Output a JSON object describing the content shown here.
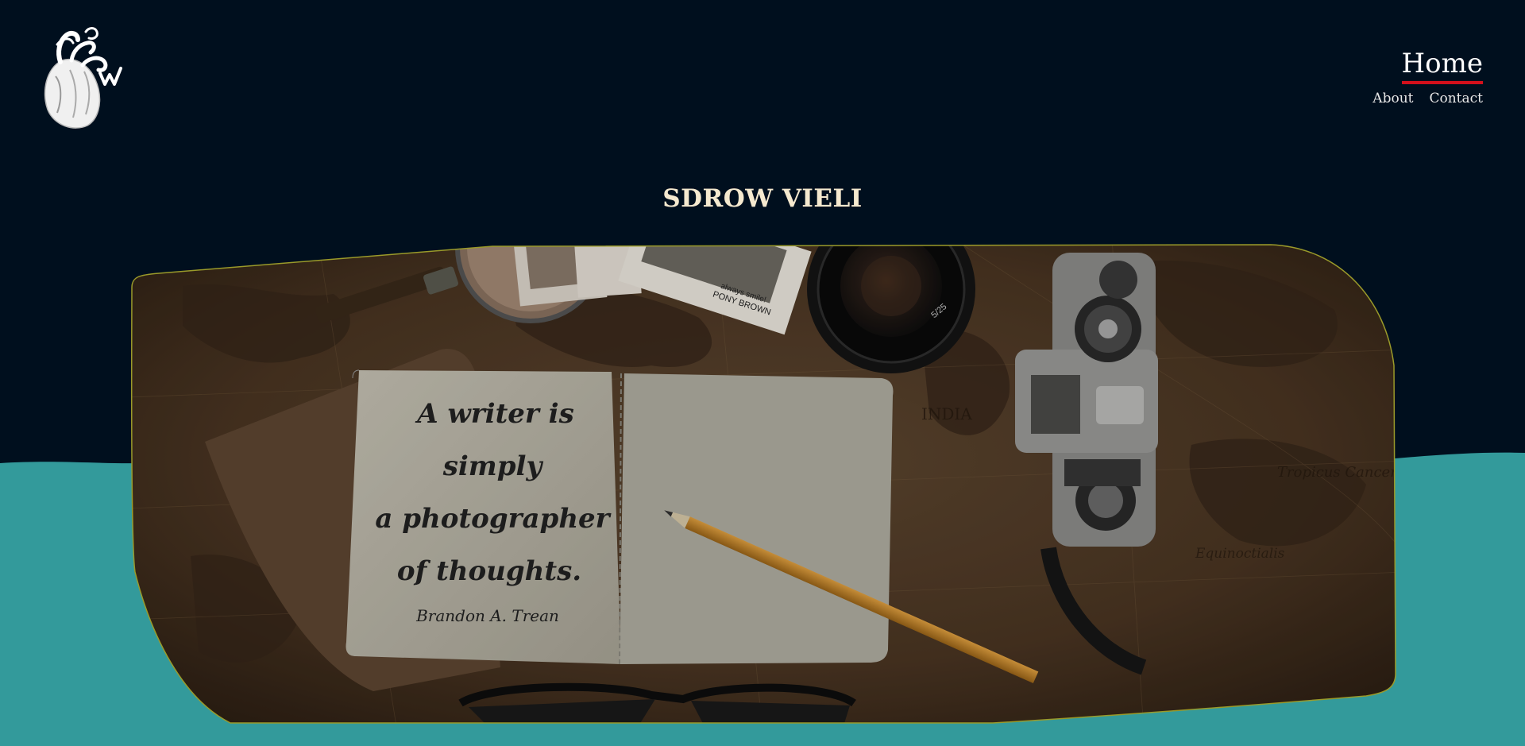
{
  "colors": {
    "background": "#000f1e",
    "teal": "#339a9b",
    "nav_underline": "#d3101b",
    "title": "#f5e9cf",
    "hero_border": "#9a9a2a"
  },
  "header": {
    "logo_icon": "anatomical-heart-logo",
    "nav": {
      "active": "Home",
      "links": [
        "About",
        "Contact"
      ]
    }
  },
  "site_title": "SDROW VIELI",
  "hero": {
    "notebook_quote": {
      "lines": [
        "A writer is",
        "simply",
        "a photographer",
        "of thoughts."
      ],
      "author": "Brandon A. Trean"
    },
    "photo_caption_lines": [
      "always smile!",
      "PONY BROWN"
    ],
    "lens_markings": [
      "5/25"
    ],
    "map_labels": [
      "INDIA",
      "Tropicus Cancer",
      "Equinoctialis"
    ]
  }
}
